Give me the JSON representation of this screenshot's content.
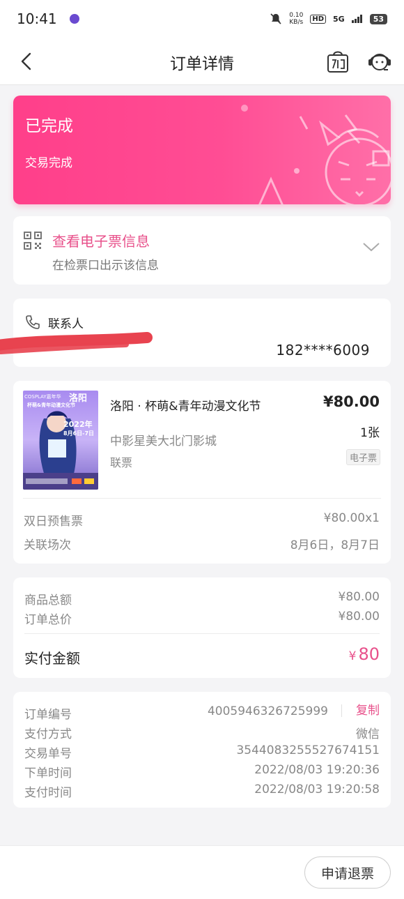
{
  "status_bar": {
    "time": "10:41",
    "net_speed": "0.10",
    "net_unit": "KB/s",
    "hd": "HD",
    "signal": "5G",
    "battery": "53"
  },
  "nav": {
    "title": "订单详情",
    "back_icon": "chevron-left-icon",
    "shop_icon": "shopping-bag-icon",
    "service_icon": "customer-service-icon"
  },
  "order_status": {
    "title": "已完成",
    "subtitle": "交易完成"
  },
  "eticket": {
    "title": "查看电子票信息",
    "subtitle": "在检票口出示该信息"
  },
  "contact": {
    "label": "联系人",
    "phone": "182****6009"
  },
  "product": {
    "name": "洛阳 · 杯萌&青年动漫文化节",
    "price": "¥80.00",
    "quantity": "1张",
    "venue": "中影星美大北门影城",
    "ticket_type": "联票",
    "tag": "电子票",
    "poster_text": [
      "COSPLAY嘉年华",
      "洛阳",
      "杯萌&青年动漫文化节",
      "2022年",
      "8月6日-7日"
    ],
    "rows": [
      {
        "label": "双日预售票",
        "value": "¥80.00x1"
      },
      {
        "label": "关联场次",
        "value": "8月6日，8月7日"
      }
    ]
  },
  "totals": {
    "rows": [
      {
        "label": "商品总额",
        "value": "¥80.00"
      },
      {
        "label": "订单总价",
        "value": "¥80.00"
      }
    ],
    "paid_label": "实付金额",
    "paid_currency": "¥",
    "paid_value": "80"
  },
  "info": {
    "copy_label": "复制",
    "rows": [
      {
        "label": "订单编号",
        "value": "4005946326725999"
      },
      {
        "label": "支付方式",
        "value": "微信"
      },
      {
        "label": "交易单号",
        "value": "3544083255527674151"
      },
      {
        "label": "下单时间",
        "value": "2022/08/03 19:20:36"
      },
      {
        "label": "支付时间",
        "value": "2022/08/03 19:20:58"
      }
    ]
  },
  "refund_label": "申请退票",
  "colors": {
    "accent": "#e8518b",
    "hero_start": "#ff3f8a",
    "hero_end": "#ff6fa8"
  }
}
